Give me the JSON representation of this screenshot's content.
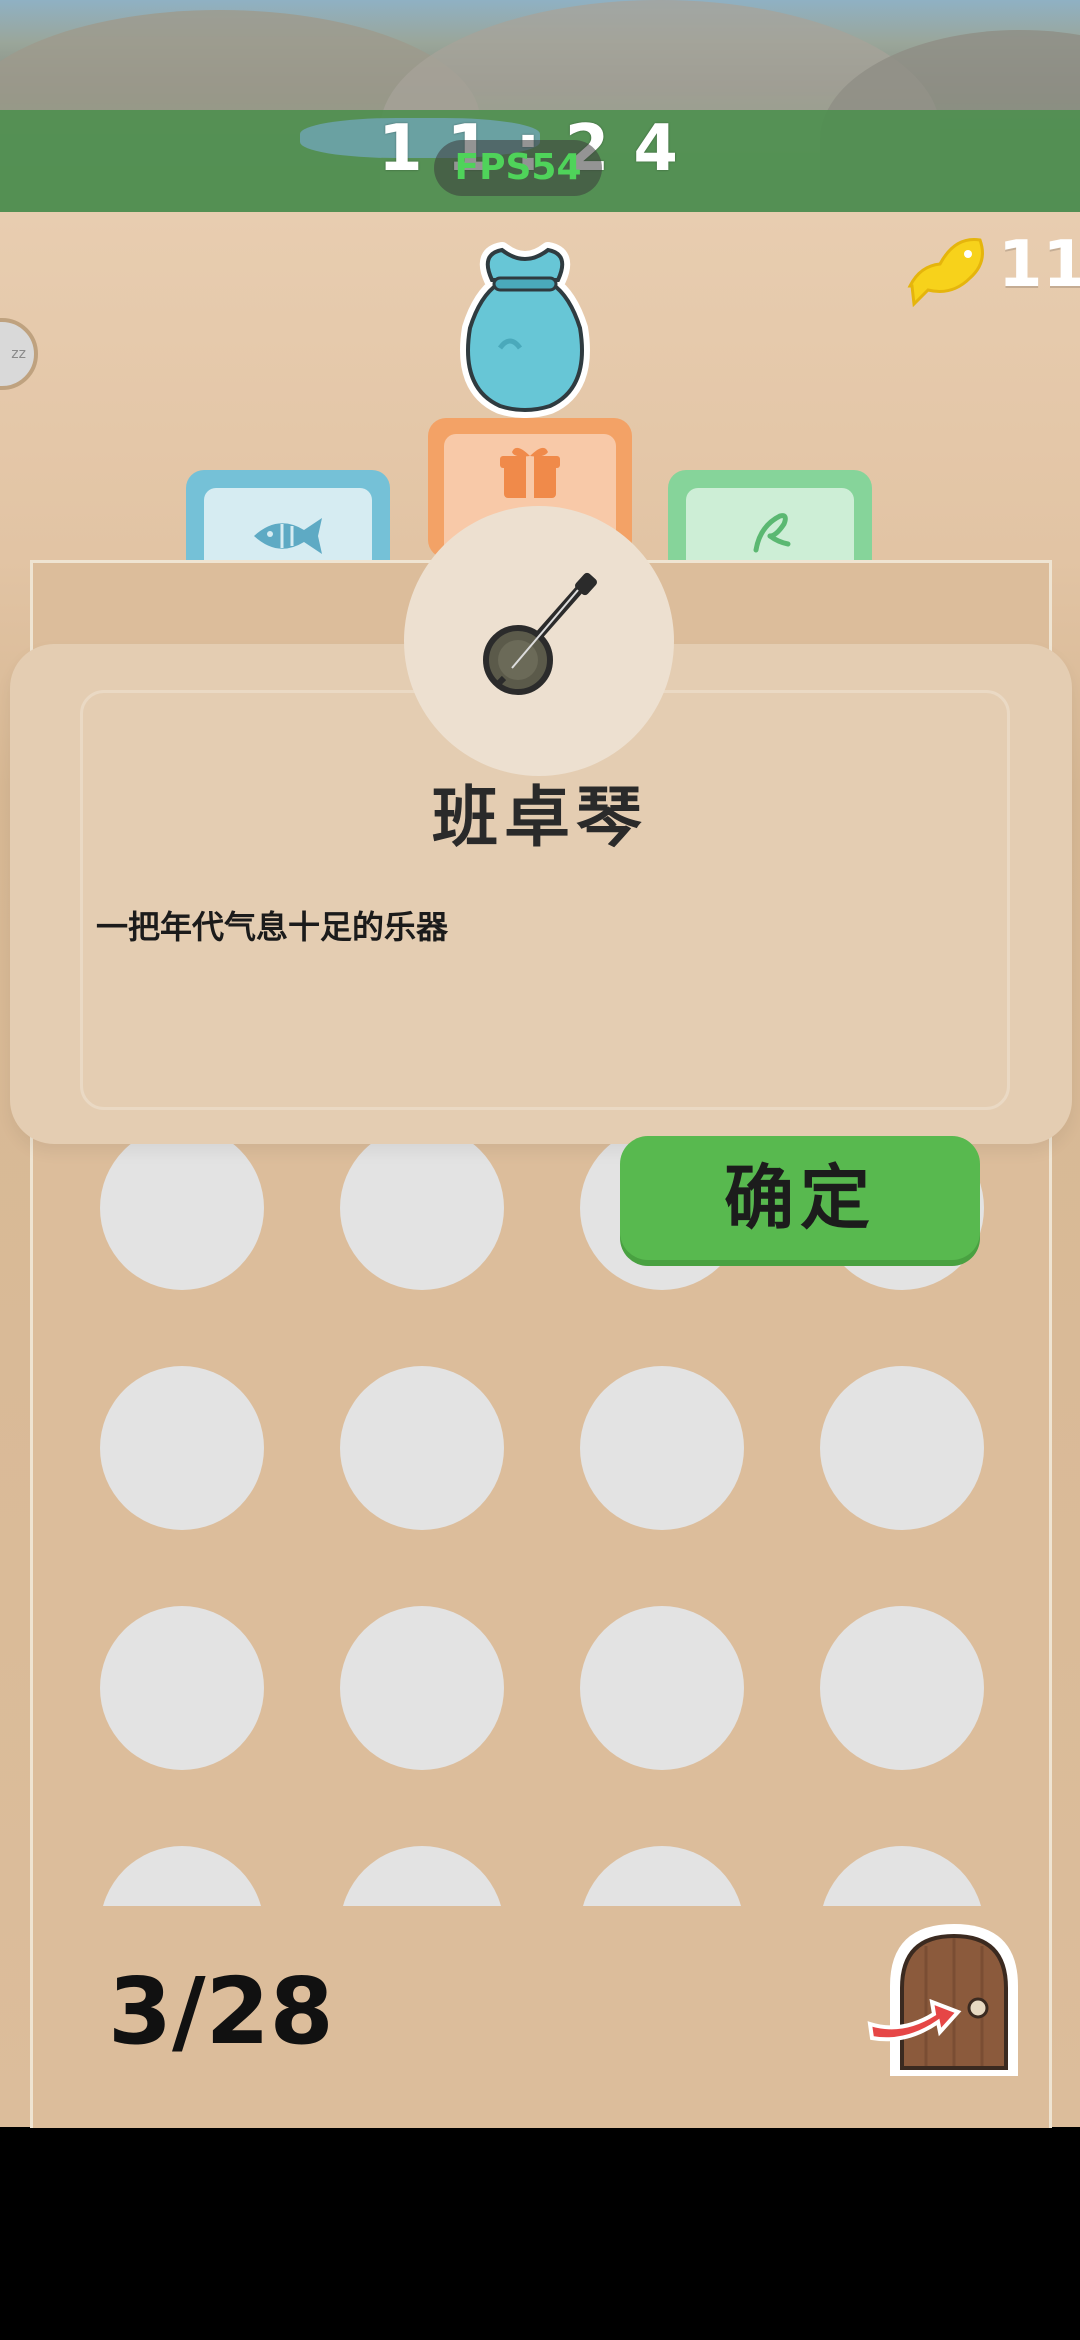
{
  "status_bar": {
    "clock": "11:24",
    "fps": "FPS54"
  },
  "currency": {
    "icon": "fish-coin-icon",
    "count": "11",
    "color": "#f7d21b"
  },
  "tabs": [
    {
      "name": "fish",
      "icon": "fish-icon",
      "color": "#75c1d7"
    },
    {
      "name": "gift",
      "icon": "gift-box-icon",
      "color": "#f3a266",
      "selected": true
    },
    {
      "name": "leaf",
      "icon": "leaf-icon",
      "color": "#86d49a"
    }
  ],
  "detail": {
    "item_icon": "banjo-icon",
    "title": "班卓琴",
    "description": "一把年代气息十足的乐器"
  },
  "confirm_button": {
    "label": "确定",
    "color": "#58b94f"
  },
  "collection": {
    "counter": "3/28"
  },
  "exit": {
    "icon": "exit-door-icon"
  }
}
